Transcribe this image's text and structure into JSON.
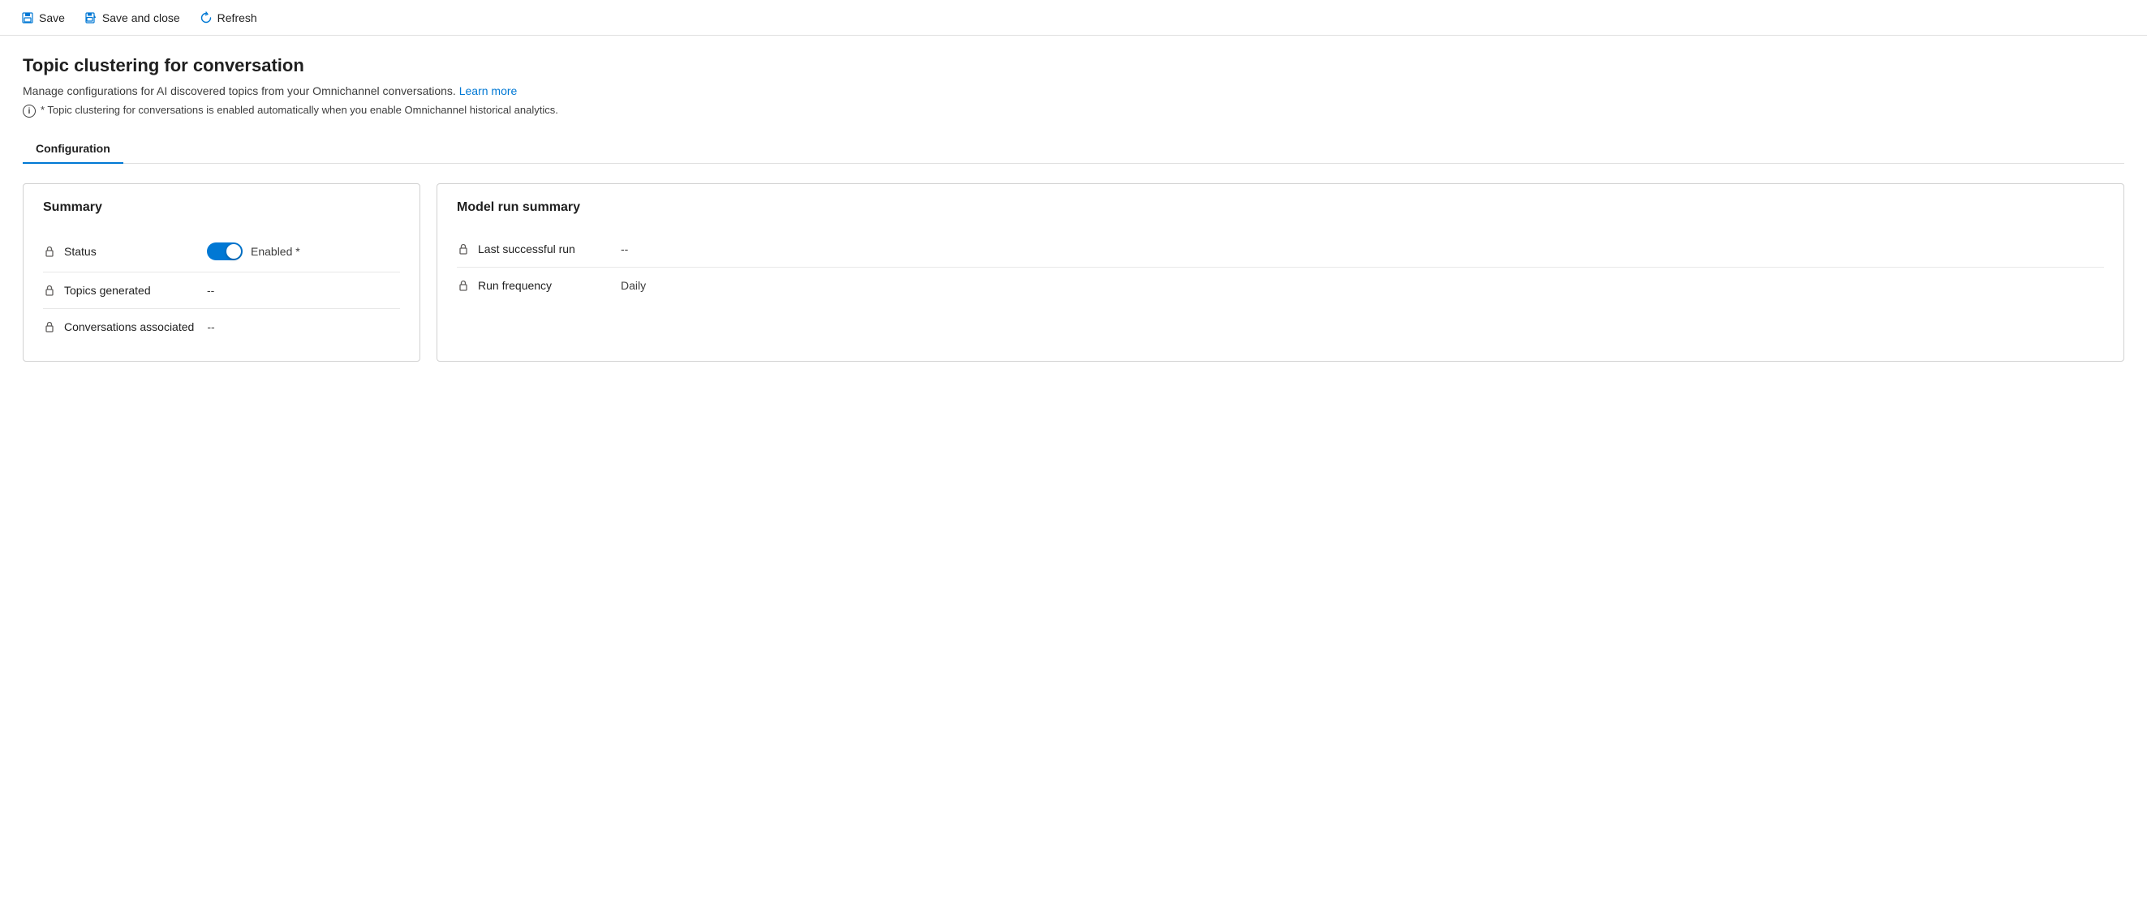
{
  "toolbar": {
    "save_label": "Save",
    "save_close_label": "Save and close",
    "refresh_label": "Refresh"
  },
  "page": {
    "title": "Topic clustering for conversation",
    "description": "Manage configurations for AI discovered topics from your Omnichannel conversations.",
    "learn_more_label": "Learn more",
    "info_note": "* Topic clustering for conversations is enabled automatically when you enable Omnichannel historical analytics."
  },
  "tabs": [
    {
      "label": "Configuration",
      "active": true
    }
  ],
  "summary_card": {
    "title": "Summary",
    "fields": [
      {
        "label": "Status",
        "type": "toggle",
        "toggle_on": true,
        "toggle_text": "Enabled *"
      },
      {
        "label": "Topics generated",
        "value": "--"
      },
      {
        "label": "Conversations associated",
        "value": "--"
      }
    ]
  },
  "model_run_card": {
    "title": "Model run summary",
    "fields": [
      {
        "label": "Last successful run",
        "value": "--"
      },
      {
        "label": "Run frequency",
        "value": "Daily"
      }
    ]
  }
}
